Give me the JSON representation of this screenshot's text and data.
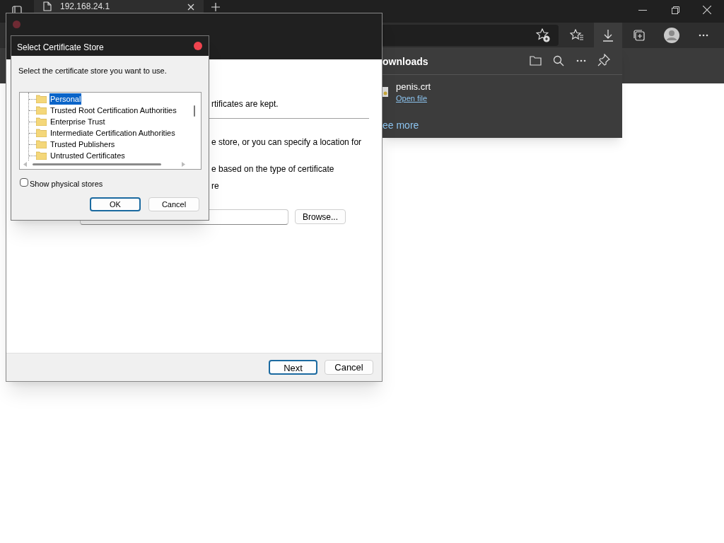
{
  "browser": {
    "tab": {
      "title": "192.168.24.1"
    }
  },
  "downloads": {
    "title": "ownloads",
    "items": [
      {
        "name": "penis.crt",
        "action": "Open file"
      }
    ],
    "see_more": "ee more"
  },
  "wizard": {
    "texts": [
      "rtificates are kept.",
      "e store, or you can specify a location for",
      "e based on the type of certificate",
      "re"
    ],
    "browse_button": "Browse...",
    "buttons": [
      {
        "label": "Next",
        "default": true
      },
      {
        "label": "Cancel",
        "default": false
      }
    ]
  },
  "dialog": {
    "title": "Select Certificate Store",
    "prompt": "Select the certificate store you want to use.",
    "stores": [
      {
        "label": "Personal",
        "selected": true
      },
      {
        "label": "Trusted Root Certification Authorities",
        "selected": false
      },
      {
        "label": "Enterprise Trust",
        "selected": false
      },
      {
        "label": "Intermediate Certification Authorities",
        "selected": false
      },
      {
        "label": "Trusted Publishers",
        "selected": false
      },
      {
        "label": "Untrusted Certificates",
        "selected": false
      }
    ],
    "show_physical_stores": {
      "label": "Show physical stores",
      "checked": false
    },
    "buttons": [
      {
        "label": "OK",
        "default": true
      },
      {
        "label": "Cancel",
        "default": false
      }
    ]
  }
}
